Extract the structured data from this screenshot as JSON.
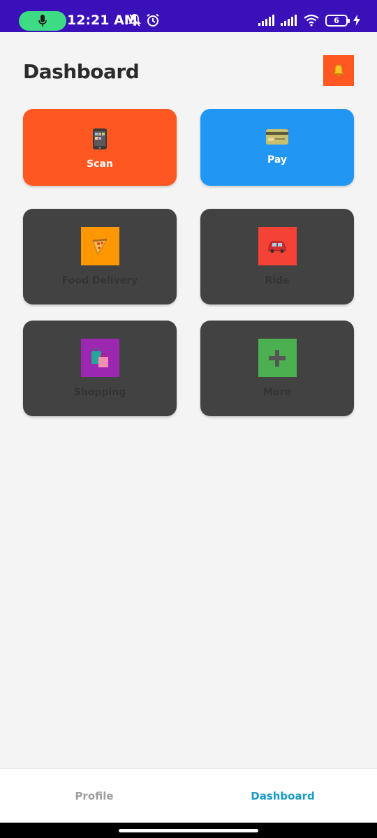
{
  "status_bar": {
    "time": "12:21 AM",
    "battery_level": "6",
    "icons": [
      "mic-icon",
      "bell-off-icon",
      "alarm-icon",
      "signal-icon",
      "signal-icon",
      "wifi-icon",
      "battery-icon",
      "charging-icon"
    ],
    "background_color": "#3a10b8"
  },
  "header": {
    "title": "Dashboard",
    "notification_icon": "bell-icon",
    "notification_button_color": "#ff5722"
  },
  "quick_actions": [
    {
      "label": "Scan",
      "icon": "phone-icon",
      "color": "#ff5722"
    },
    {
      "label": "Pay",
      "icon": "credit-card-icon",
      "color": "#2196f3"
    }
  ],
  "services": [
    {
      "label": "Food Delivery",
      "icon": "pizza-icon",
      "color": "#ff9800"
    },
    {
      "label": "Ride",
      "icon": "car-icon",
      "color": "#f44336"
    },
    {
      "label": "Shopping",
      "icon": "shopping-bags-icon",
      "color": "#9c27b0"
    },
    {
      "label": "More",
      "icon": "plus-icon",
      "color": "#4caf50"
    }
  ],
  "bottom_nav": {
    "items": [
      {
        "label": "Profile",
        "active": false
      },
      {
        "label": "Dashboard",
        "active": true
      }
    ],
    "active_color": "#1a9bc3"
  }
}
